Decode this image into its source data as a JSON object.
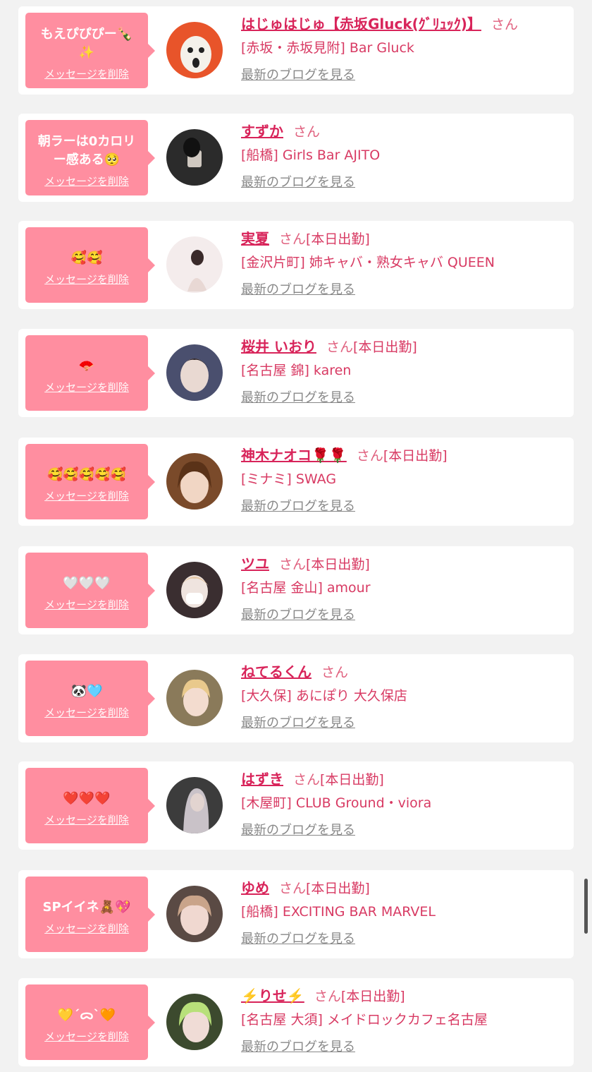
{
  "delete_label": "メッセージを削除",
  "blog_label": "最新のブログを見る",
  "san_label": "さん",
  "entries": [
    {
      "message": "もえぴぴぴー🍾\n✨",
      "name": "はじゅはじゅ【赤坂Gluck(ｸﾞﾘｭｯｸ)】",
      "today": "",
      "shop": "[赤坂・赤坂見附] Bar Gluck",
      "avatar_colors": [
        "#e8542a",
        "#f4f1ea"
      ]
    },
    {
      "message": "朝ラーは0カロリー感ある🥺",
      "name": "すずか",
      "today": "",
      "shop": "[船橋] Girls Bar AJITO",
      "avatar_colors": [
        "#2b2b2b",
        "#cfc8c0"
      ]
    },
    {
      "message": "🥰🥰",
      "name": "実夏",
      "today": "[本日出勤]",
      "shop": "[金沢片町] 姉キャバ・熟女キャバ QUEEN",
      "avatar_colors": [
        "#f4ecec",
        "#3a2a2a"
      ]
    },
    {
      "message": "🪭",
      "name": "桜井 いおり",
      "today": "[本日出勤]",
      "shop": "[名古屋 錦] karen",
      "avatar_colors": [
        "#4a4f6e",
        "#e9d9d2"
      ]
    },
    {
      "message": "🥰🥰🥰🥰🥰",
      "name": "神木ナオコ🌹🌹",
      "today": "[本日出勤]",
      "shop": "[ミナミ] SWAG",
      "avatar_colors": [
        "#7a4a2a",
        "#f1d6c4"
      ]
    },
    {
      "message": "🤍🤍🤍",
      "name": "ツユ",
      "today": "[本日出勤]",
      "shop": "[名古屋 金山] amour",
      "avatar_colors": [
        "#3a2e30",
        "#efe4df"
      ]
    },
    {
      "message": "🐼🩵",
      "name": "ねてるくん",
      "today": "",
      "shop": "[大久保] あにぽり 大久保店",
      "avatar_colors": [
        "#8a7a5a",
        "#f3dccf"
      ]
    },
    {
      "message": "❤️❤️❤️",
      "name": "はずき",
      "today": "[本日出勤]",
      "shop": "[木屋町] CLUB Ground・viora",
      "avatar_colors": [
        "#3c3c3c",
        "#c9c2c8"
      ]
    },
    {
      "message": "SPイイネ🧸💖",
      "name": "ゆめ",
      "today": "[本日出勤]",
      "shop": "[船橋] EXCITING BAR MARVEL",
      "avatar_colors": [
        "#5a4a44",
        "#f0d8d0"
      ]
    },
    {
      "message": "💛ˊᯅˋ🧡",
      "name": "⚡️りせ⚡️",
      "today": "[本日出勤]",
      "shop": "[名古屋 大須] メイドロックカフェ名古屋",
      "avatar_colors": [
        "#3c4a2e",
        "#b8e07a"
      ]
    }
  ]
}
